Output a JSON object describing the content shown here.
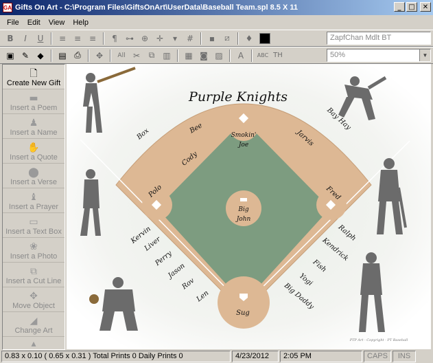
{
  "window": {
    "title": "Gifts On Art - C:\\Program Files\\GiftsOnArt\\UserData\\Baseball Team.spl 8.5 X 11",
    "icon_text": "GA",
    "min_glyph": "_",
    "max_glyph": "□",
    "close_glyph": "✕"
  },
  "menu": {
    "items": [
      "File",
      "Edit",
      "View",
      "Help"
    ]
  },
  "toolbar": {
    "font_name": "ZapfChan Mdlt BT",
    "zoom": "50%",
    "text_color": "#000000"
  },
  "toolbar2": {
    "all_label": "All",
    "abc_label": "ABC",
    "th_label": "TH",
    "a_label": "A"
  },
  "sidebar": {
    "items": [
      {
        "label": "Create New Gift",
        "icon": "document-icon"
      },
      {
        "label": "Insert a Poem",
        "icon": "poem-icon"
      },
      {
        "label": "Insert a Name",
        "icon": "name-icon"
      },
      {
        "label": "Insert a Quote",
        "icon": "quote-icon"
      },
      {
        "label": "Insert a Verse",
        "icon": "verse-icon"
      },
      {
        "label": "Insert a Prayer",
        "icon": "prayer-icon"
      },
      {
        "label": "Insert a Text Box",
        "icon": "textbox-icon"
      },
      {
        "label": "Insert a Photo",
        "icon": "photo-icon"
      },
      {
        "label": "Insert a Cut Line",
        "icon": "cutline-icon"
      },
      {
        "label": "Move Object",
        "icon": "move-icon"
      },
      {
        "label": "Change Art",
        "icon": "art-icon"
      }
    ]
  },
  "art": {
    "title": "Purple Knights",
    "copyright": "PTP Art - Copyright - PT Baseball",
    "names": {
      "box": "Box",
      "bee": "Bee",
      "smokin1": "Smokin'",
      "smokin2": "Joe",
      "jarvis": "Jarvis",
      "bay_hay": "Bay Hay",
      "cody": "Cody",
      "polo": "Polo",
      "fred": "Fred",
      "big1": "Big",
      "big2": "John",
      "kervin": "Kervin",
      "liver": "Liver",
      "perry": "Perry",
      "jason": "Jason",
      "rov": "Rov",
      "len": "Len",
      "ralph": "Ralph",
      "kendrick": "Kendrick",
      "fish": "Fish",
      "yogi": "Yogi",
      "big_daddy": "Big Daddy",
      "sug": "Sug"
    }
  },
  "status": {
    "coords": "0.83 x 0.10 ( 0.65 x 0.31 )",
    "prints": "Total Prints 0 Daily Prints 0",
    "date": "4/23/2012",
    "time": "2:05 PM",
    "caps": "CAPS",
    "ins": "INS"
  }
}
